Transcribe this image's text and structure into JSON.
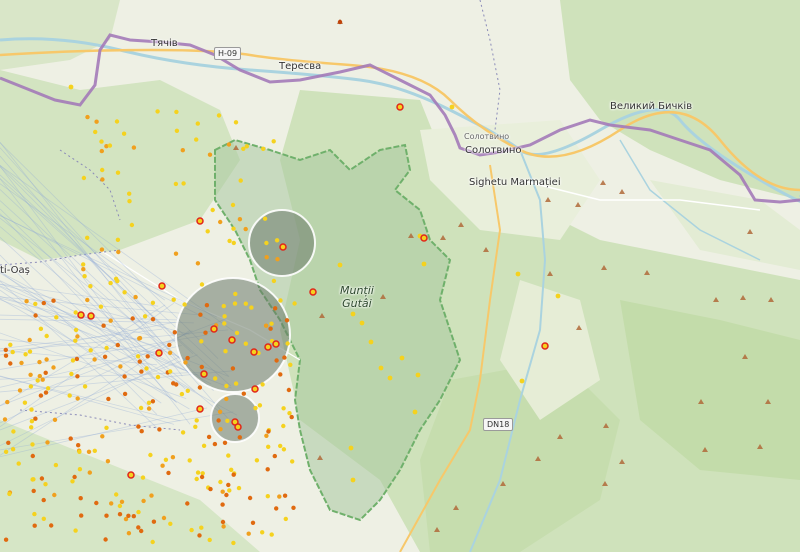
{
  "map": {
    "labels": {
      "tiachiv": "Тячів",
      "teresva": "Тересва",
      "velykyi_bychkiv": "Великий Бичків",
      "solotvyno_small": "Солотвино",
      "solotvyno": "Солотвино",
      "sighetu": "Sighetu Marmației",
      "muntii_gutai_line1": "Munții",
      "muntii_gutai_line2": "Gutâi",
      "oas": "ti-Oaș"
    },
    "road_shields": {
      "h09": "H-09",
      "dn18": "DN18"
    }
  },
  "colors": {
    "land": "#f2efe9",
    "forest": "#cde3bc",
    "forest_dark": "#b9d6a3",
    "protected_area": "#a9c9a0",
    "protected_border": "#6fb06b",
    "border": "#a37ab8",
    "river": "#aad3df",
    "road": "#f7c86a",
    "cluster_fill": "#6b7a6b",
    "dot_yellow": "#f5d21e",
    "dot_orange": "#f0a01e",
    "dot_dark_orange": "#e06a10",
    "dot_red": "#e0261a",
    "peak": "#b06a3a"
  }
}
